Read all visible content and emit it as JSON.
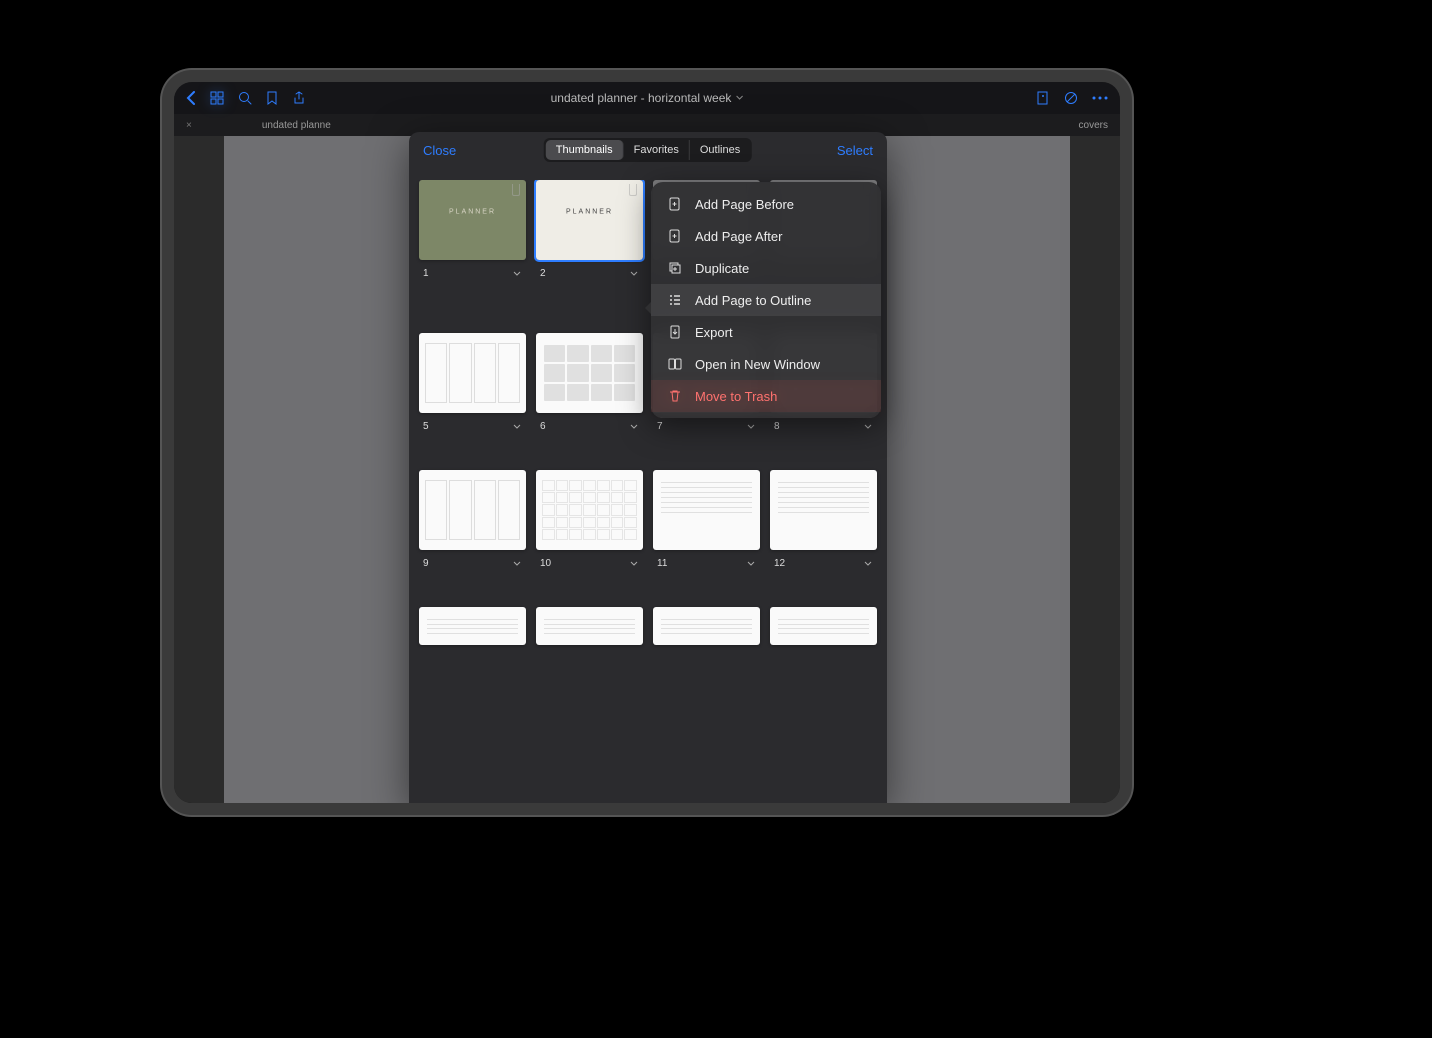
{
  "toolbar": {
    "title": "undated planner - horizontal week",
    "tab_label": "undated planne",
    "tab_extra": "covers"
  },
  "sheet": {
    "close": "Close",
    "select": "Select",
    "segments": [
      "Thumbnails",
      "Favorites",
      "Outlines"
    ],
    "active_segment": 0,
    "planner_label": "PLANNER",
    "pages_row1": [
      "1",
      "2",
      "",
      ""
    ],
    "pages_row2": [
      "5",
      "6",
      "7",
      "8"
    ],
    "pages_row3": [
      "9",
      "10",
      "11",
      "12"
    ]
  },
  "menu": {
    "items": [
      {
        "label": "Add Page Before",
        "icon": "doc-plus-before"
      },
      {
        "label": "Add Page After",
        "icon": "doc-plus-after"
      },
      {
        "label": "Duplicate",
        "icon": "duplicate"
      },
      {
        "label": "Add Page to Outline",
        "icon": "list"
      },
      {
        "label": "Export",
        "icon": "export"
      },
      {
        "label": "Open in New Window",
        "icon": "new-window"
      },
      {
        "label": "Move to Trash",
        "icon": "trash",
        "danger": true,
        "selected": true
      }
    ]
  }
}
